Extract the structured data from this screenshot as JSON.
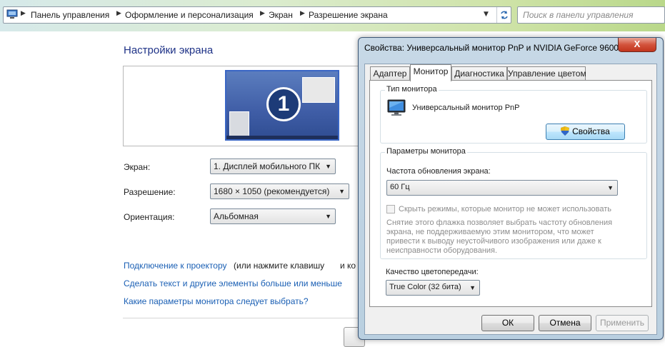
{
  "address_bar": {
    "breadcrumbs": [
      "Панель управления",
      "Оформление и персонализация",
      "Экран",
      "Разрешение экрана"
    ],
    "search_placeholder": "Поиск в панели управления"
  },
  "main": {
    "title": "Настройки экрана",
    "monitor_number": "1",
    "fields": {
      "screen_label": "Экран:",
      "screen_value": "1. Дисплей мобильного ПК",
      "resolution_label": "Разрешение:",
      "resolution_value": "1680 × 1050 (рекомендуется)",
      "orientation_label": "Ориентация:",
      "orientation_value": "Альбомная"
    },
    "links": {
      "projector": "Подключение к проектору",
      "projector_suffix": "(или нажмите клавишу",
      "projector_tail": "и ко",
      "text_size": "Сделать текст и другие элементы больше или меньше",
      "which_params": "Какие параметры монитора следует выбрать?"
    }
  },
  "dialog": {
    "title": "Свойства: Универсальный монитор PnP и NVIDIA GeForce 9600...",
    "close": "X",
    "tabs": [
      "Адаптер",
      "Монитор",
      "Диагностика",
      "Управление цветом"
    ],
    "active_tab": "Монитор",
    "monitor_type": {
      "heading": "Тип монитора",
      "name": "Универсальный монитор PnP",
      "properties_button": "Свойства"
    },
    "monitor_params": {
      "heading": "Параметры монитора",
      "refresh_label": "Частота обновления экрана:",
      "refresh_value": "60 Гц",
      "hide_modes_label": "Скрыть режимы, которые монитор не может использовать",
      "hide_modes_checked": false,
      "note": [
        "Снятие этого флажка позволяет выбрать частоту обновления",
        "экрана, не поддерживаемую этим монитором, что может",
        "привести к выводу неустойчивого изображения или даже к",
        "неисправности оборудования."
      ]
    },
    "color": {
      "label": "Качество цветопередачи:",
      "value": "True Color (32 бита)"
    },
    "buttons": {
      "ok": "ОК",
      "cancel": "Отмена",
      "apply": "Применить"
    }
  }
}
